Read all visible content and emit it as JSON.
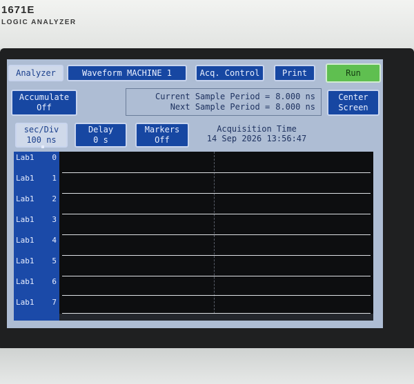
{
  "device": {
    "model": "1671E",
    "subtitle": "LOGIC ANALYZER"
  },
  "toolbar": {
    "analyzer": "Analyzer",
    "waveform": "Waveform MACHINE 1",
    "acq_control": "Acq. Control",
    "print": "Print",
    "run": "Run"
  },
  "accumulate": {
    "label": "Accumulate",
    "value": "Off"
  },
  "sample_period": {
    "current_label": "Current Sample Period =",
    "current_value": "8.000 ns",
    "next_label": "Next Sample Period =",
    "next_value": "8.000 ns"
  },
  "center_screen": {
    "line1": "Center",
    "line2": "Screen"
  },
  "sec_div": {
    "label": "sec/Div",
    "value": "100 ns"
  },
  "delay": {
    "label": "Delay",
    "value": "0 s"
  },
  "markers": {
    "label": "Markers",
    "value": "Off"
  },
  "acquisition": {
    "label": "Acquisition Time",
    "value": "14 Sep 2026 13:56:47"
  },
  "channels": [
    {
      "label": "Lab1",
      "bit": "0"
    },
    {
      "label": "Lab1",
      "bit": "1"
    },
    {
      "label": "Lab1",
      "bit": "2"
    },
    {
      "label": "Lab1",
      "bit": "3"
    },
    {
      "label": "Lab1",
      "bit": "4"
    },
    {
      "label": "Lab1",
      "bit": "5"
    },
    {
      "label": "Lab1",
      "bit": "6"
    },
    {
      "label": "Lab1",
      "bit": "7"
    }
  ],
  "colors": {
    "button": "#1747a2",
    "screen": "#aebdd4",
    "run": "#5fbf50",
    "waveform_bg": "#0d0e10"
  }
}
